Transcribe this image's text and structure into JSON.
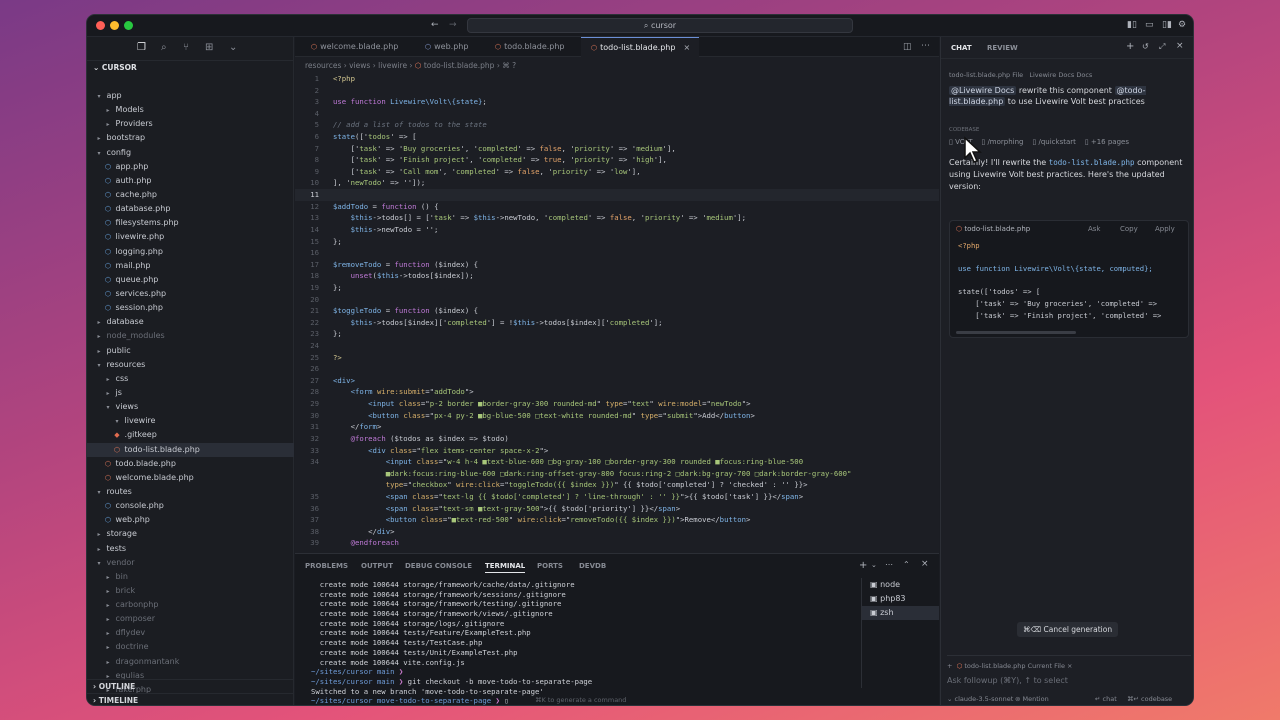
{
  "colors": {
    "kw": "#c07ad8",
    "str": "#a8c77a",
    "var": "#7fb5e8",
    "num": "#e5a46a",
    "cmt": "#6c7480",
    "fn": "#7fb5e8",
    "tag": "#7fb5e8",
    "attr": "#d7b06a",
    "plain": "#c9ccd3"
  },
  "titlebar": {
    "search": "cursor"
  },
  "sidebar": {
    "root": "CURSOR",
    "items": [
      {
        "label": "app",
        "d": 1,
        "k": "open"
      },
      {
        "label": "Models",
        "d": 2,
        "k": "closed",
        "dim": false
      },
      {
        "label": "Providers",
        "d": 2,
        "k": "closed"
      },
      {
        "label": "bootstrap",
        "d": 1,
        "k": "closed"
      },
      {
        "label": "config",
        "d": 1,
        "k": "open"
      },
      {
        "label": "app.php",
        "d": 2,
        "k": "php"
      },
      {
        "label": "auth.php",
        "d": 2,
        "k": "php"
      },
      {
        "label": "cache.php",
        "d": 2,
        "k": "php"
      },
      {
        "label": "database.php",
        "d": 2,
        "k": "php"
      },
      {
        "label": "filesystems.php",
        "d": 2,
        "k": "php"
      },
      {
        "label": "livewire.php",
        "d": 2,
        "k": "php"
      },
      {
        "label": "logging.php",
        "d": 2,
        "k": "php"
      },
      {
        "label": "mail.php",
        "d": 2,
        "k": "php"
      },
      {
        "label": "queue.php",
        "d": 2,
        "k": "php"
      },
      {
        "label": "services.php",
        "d": 2,
        "k": "php"
      },
      {
        "label": "session.php",
        "d": 2,
        "k": "php"
      },
      {
        "label": "database",
        "d": 1,
        "k": "closed"
      },
      {
        "label": "node_modules",
        "d": 1,
        "k": "closed",
        "dim": true
      },
      {
        "label": "public",
        "d": 1,
        "k": "closed"
      },
      {
        "label": "resources",
        "d": 1,
        "k": "open"
      },
      {
        "label": "css",
        "d": 2,
        "k": "closed"
      },
      {
        "label": "js",
        "d": 2,
        "k": "closed"
      },
      {
        "label": "views",
        "d": 2,
        "k": "open"
      },
      {
        "label": "livewire",
        "d": 3,
        "k": "open"
      },
      {
        "label": ".gitkeep",
        "d": 3,
        "k": "git"
      },
      {
        "label": "todo-list.blade.php",
        "d": 3,
        "k": "blade",
        "sel": true
      },
      {
        "label": "todo.blade.php",
        "d": 2,
        "k": "blade"
      },
      {
        "label": "welcome.blade.php",
        "d": 2,
        "k": "blade"
      },
      {
        "label": "routes",
        "d": 1,
        "k": "open"
      },
      {
        "label": "console.php",
        "d": 2,
        "k": "php"
      },
      {
        "label": "web.php",
        "d": 2,
        "k": "php"
      },
      {
        "label": "storage",
        "d": 1,
        "k": "closed"
      },
      {
        "label": "tests",
        "d": 1,
        "k": "closed"
      },
      {
        "label": "vendor",
        "d": 1,
        "k": "open",
        "dim": true
      },
      {
        "label": "bin",
        "d": 2,
        "k": "closed",
        "dim": true
      },
      {
        "label": "brick",
        "d": 2,
        "k": "closed",
        "dim": true
      },
      {
        "label": "carbonphp",
        "d": 2,
        "k": "closed",
        "dim": true
      },
      {
        "label": "composer",
        "d": 2,
        "k": "closed",
        "dim": true
      },
      {
        "label": "dflydev",
        "d": 2,
        "k": "closed",
        "dim": true
      },
      {
        "label": "doctrine",
        "d": 2,
        "k": "closed",
        "dim": true
      },
      {
        "label": "dragonmantank",
        "d": 2,
        "k": "closed",
        "dim": true
      },
      {
        "label": "egulias",
        "d": 2,
        "k": "closed",
        "dim": true
      },
      {
        "label": "fakerphp",
        "d": 2,
        "k": "closed",
        "dim": true
      }
    ],
    "outline": "OUTLINE",
    "timeline": "TIMELINE"
  },
  "tabs": [
    "welcome.blade.php",
    "web.php",
    "todo.blade.php",
    "todo-list.blade.php"
  ],
  "breadcrumb": {
    "a": "resources",
    "b": "views",
    "c": "livewire",
    "d": "todo-list.blade.php"
  },
  "code": [
    [
      [
        "t",
        "<?php"
      ]
    ],
    [],
    [
      [
        "kw",
        "use function "
      ],
      [
        "fn",
        "Livewire\\Volt\\{state}"
      ],
      [
        "plain",
        ";"
      ]
    ],
    [],
    [
      [
        "cmt",
        "// add a list of todos to the state"
      ]
    ],
    [
      [
        "fn",
        "state"
      ],
      [
        "plain",
        "(['"
      ],
      [
        "str",
        "todos"
      ],
      [
        "plain",
        "' => ["
      ]
    ],
    [
      [
        "plain",
        "    ['"
      ],
      [
        "str",
        "task"
      ],
      [
        "plain",
        "' => '"
      ],
      [
        "str",
        "Buy groceries"
      ],
      [
        "plain",
        "', '"
      ],
      [
        "str",
        "completed"
      ],
      [
        "plain",
        "' => "
      ],
      [
        "num",
        "false"
      ],
      [
        "plain",
        ", '"
      ],
      [
        "str",
        "priority"
      ],
      [
        "plain",
        "' => '"
      ],
      [
        "str",
        "medium"
      ],
      [
        "plain",
        "'],"
      ]
    ],
    [
      [
        "plain",
        "    ['"
      ],
      [
        "str",
        "task"
      ],
      [
        "plain",
        "' => '"
      ],
      [
        "str",
        "Finish project"
      ],
      [
        "plain",
        "', '"
      ],
      [
        "str",
        "completed"
      ],
      [
        "plain",
        "' => "
      ],
      [
        "num",
        "true"
      ],
      [
        "plain",
        ", '"
      ],
      [
        "str",
        "priority"
      ],
      [
        "plain",
        "' => '"
      ],
      [
        "str",
        "high"
      ],
      [
        "plain",
        "'],"
      ]
    ],
    [
      [
        "plain",
        "    ['"
      ],
      [
        "str",
        "task"
      ],
      [
        "plain",
        "' => '"
      ],
      [
        "str",
        "Call mom"
      ],
      [
        "plain",
        "', '"
      ],
      [
        "str",
        "completed"
      ],
      [
        "plain",
        "' => "
      ],
      [
        "num",
        "false"
      ],
      [
        "plain",
        ", '"
      ],
      [
        "str",
        "priority"
      ],
      [
        "plain",
        "' => '"
      ],
      [
        "str",
        "low"
      ],
      [
        "plain",
        "'],"
      ]
    ],
    [
      [
        "plain",
        "], '"
      ],
      [
        "str",
        "newTodo"
      ],
      [
        "plain",
        "' => '']);"
      ]
    ],
    [],
    [
      [
        "var",
        "$addTodo"
      ],
      [
        "plain",
        " = "
      ],
      [
        "kw",
        "function"
      ],
      [
        "plain",
        " () {"
      ]
    ],
    [
      [
        "plain",
        "    "
      ],
      [
        "var",
        "$this"
      ],
      [
        "plain",
        "->todos[] = ['"
      ],
      [
        "str",
        "task"
      ],
      [
        "plain",
        "' => "
      ],
      [
        "var",
        "$this"
      ],
      [
        "plain",
        "->newTodo, '"
      ],
      [
        "str",
        "completed"
      ],
      [
        "plain",
        "' => "
      ],
      [
        "num",
        "false"
      ],
      [
        "plain",
        ", '"
      ],
      [
        "str",
        "priority"
      ],
      [
        "plain",
        "' => '"
      ],
      [
        "str",
        "medium"
      ],
      [
        "plain",
        "'];"
      ]
    ],
    [
      [
        "plain",
        "    "
      ],
      [
        "var",
        "$this"
      ],
      [
        "plain",
        "->newTodo = '';"
      ]
    ],
    [
      [
        "plain",
        "};"
      ]
    ],
    [],
    [
      [
        "var",
        "$removeTodo"
      ],
      [
        "plain",
        " = "
      ],
      [
        "kw",
        "function"
      ],
      [
        "plain",
        " ($index) {"
      ]
    ],
    [
      [
        "plain",
        "    "
      ],
      [
        "kw",
        "unset"
      ],
      [
        "plain",
        "("
      ],
      [
        "var",
        "$this"
      ],
      [
        "plain",
        "->todos[$index]);"
      ]
    ],
    [
      [
        "plain",
        "};"
      ]
    ],
    [],
    [
      [
        "var",
        "$toggleTodo"
      ],
      [
        "plain",
        " = "
      ],
      [
        "kw",
        "function"
      ],
      [
        "plain",
        " ($index) {"
      ]
    ],
    [
      [
        "plain",
        "    "
      ],
      [
        "var",
        "$this"
      ],
      [
        "plain",
        "->todos[$index]['"
      ],
      [
        "str",
        "completed"
      ],
      [
        "plain",
        "'] = !"
      ],
      [
        "var",
        "$this"
      ],
      [
        "plain",
        "->todos[$index]['"
      ],
      [
        "str",
        "completed"
      ],
      [
        "plain",
        "'];"
      ]
    ],
    [
      [
        "plain",
        "};"
      ]
    ],
    [],
    [
      [
        "t",
        "?>"
      ]
    ],
    [],
    [
      [
        "tag",
        "<div>"
      ]
    ],
    [
      [
        "plain",
        "    "
      ],
      [
        "tag",
        "<form "
      ],
      [
        "attr",
        "wire:submit"
      ],
      [
        "plain",
        "=\""
      ],
      [
        "str",
        "addTodo"
      ],
      [
        "plain",
        "\">"
      ]
    ],
    [
      [
        "plain",
        "        "
      ],
      [
        "tag",
        "<input "
      ],
      [
        "attr",
        "class"
      ],
      [
        "plain",
        "=\""
      ],
      [
        "str",
        "p-2 border ■border-gray-300 rounded-md"
      ],
      [
        "plain",
        "\" "
      ],
      [
        "attr",
        "type"
      ],
      [
        "plain",
        "=\""
      ],
      [
        "str",
        "text"
      ],
      [
        "plain",
        "\" "
      ],
      [
        "attr",
        "wire:model"
      ],
      [
        "plain",
        "=\""
      ],
      [
        "str",
        "newTodo"
      ],
      [
        "plain",
        "\">"
      ]
    ],
    [
      [
        "plain",
        "        "
      ],
      [
        "tag",
        "<button "
      ],
      [
        "attr",
        "class"
      ],
      [
        "plain",
        "=\""
      ],
      [
        "str",
        "px-4 py-2 ■bg-blue-500 □text-white rounded-md"
      ],
      [
        "plain",
        "\" "
      ],
      [
        "attr",
        "type"
      ],
      [
        "plain",
        "=\""
      ],
      [
        "str",
        "submit"
      ],
      [
        "plain",
        "\">Add</"
      ],
      [
        "tag",
        "button"
      ],
      [
        "plain",
        ">"
      ]
    ],
    [
      [
        "plain",
        "    </"
      ],
      [
        "tag",
        "form"
      ],
      [
        "plain",
        ">"
      ]
    ],
    [
      [
        "plain",
        "    "
      ],
      [
        "kw",
        "@foreach"
      ],
      [
        "plain",
        " ($todos as $index => $todo)"
      ]
    ],
    [
      [
        "plain",
        "        "
      ],
      [
        "tag",
        "<div "
      ],
      [
        "attr",
        "class"
      ],
      [
        "plain",
        "=\""
      ],
      [
        "str",
        "flex items-center space-x-2"
      ],
      [
        "plain",
        "\">"
      ]
    ],
    [
      [
        "plain",
        "            "
      ],
      [
        "tag",
        "<input "
      ],
      [
        "attr",
        "class"
      ],
      [
        "plain",
        "=\""
      ],
      [
        "str",
        "w-4 h-4 ■text-blue-600 □bg-gray-100 □border-gray-300 rounded ■focus:ring-blue-500"
      ]
    ],
    [
      [
        "plain",
        "            "
      ],
      [
        "str",
        "■dark:focus:ring-blue-600 □dark:ring-offset-gray-800 focus:ring-2 □dark:bg-gray-700 □dark:border-gray-600\""
      ]
    ],
    [
      [
        "plain",
        "            "
      ],
      [
        "attr",
        "type"
      ],
      [
        "plain",
        "=\""
      ],
      [
        "str",
        "checkbox"
      ],
      [
        "plain",
        "\" "
      ],
      [
        "attr",
        "wire:click"
      ],
      [
        "plain",
        "=\""
      ],
      [
        "str",
        "toggleTodo({{ $index }})"
      ],
      [
        "plain",
        "\" {{ $todo['completed'] ? 'checked' : '' }}>"
      ]
    ],
    [
      [
        "plain",
        "            "
      ],
      [
        "tag",
        "<span "
      ],
      [
        "attr",
        "class"
      ],
      [
        "plain",
        "=\""
      ],
      [
        "str",
        "text-lg {{ $todo['completed'] ? 'line-through' : '' }}"
      ],
      [
        "plain",
        "\">{{ $todo['task'] }}</"
      ],
      [
        "tag",
        "span"
      ],
      [
        "plain",
        ">"
      ]
    ],
    [
      [
        "plain",
        "            "
      ],
      [
        "tag",
        "<span "
      ],
      [
        "attr",
        "class"
      ],
      [
        "plain",
        "=\""
      ],
      [
        "str",
        "text-sm ■text-gray-500"
      ],
      [
        "plain",
        "\">{{ $todo['priority'] }}</"
      ],
      [
        "tag",
        "span"
      ],
      [
        "plain",
        ">"
      ]
    ],
    [
      [
        "plain",
        "            "
      ],
      [
        "tag",
        "<button "
      ],
      [
        "attr",
        "class"
      ],
      [
        "plain",
        "=\""
      ],
      [
        "str",
        "■text-red-500"
      ],
      [
        "plain",
        "\" "
      ],
      [
        "attr",
        "wire:click"
      ],
      [
        "plain",
        "=\""
      ],
      [
        "str",
        "removeTodo({{ $index }})"
      ],
      [
        "plain",
        "\">Remove</"
      ],
      [
        "tag",
        "button"
      ],
      [
        "plain",
        ">"
      ]
    ],
    [
      [
        "plain",
        "        </"
      ],
      [
        "tag",
        "div"
      ],
      [
        "plain",
        ">"
      ]
    ],
    [
      [
        "plain",
        "    "
      ],
      [
        "kw",
        "@endforeach"
      ]
    ]
  ],
  "code_numbers": [
    "1",
    "2",
    "3",
    "4",
    "5",
    "6",
    "7",
    "8",
    "9",
    "10",
    "11",
    "12",
    "13",
    "14",
    "15",
    "16",
    "17",
    "18",
    "19",
    "20",
    "21",
    "22",
    "23",
    "24",
    "25",
    "26",
    "27",
    "28",
    "29",
    "30",
    "31",
    "32",
    "33",
    "34",
    "",
    "",
    "35",
    "36",
    "37",
    "38",
    "39"
  ],
  "panel": {
    "tabs": [
      "PROBLEMS",
      "OUTPUT",
      "DEBUG CONSOLE",
      "TERMINAL",
      "PORTS",
      "DEVDB"
    ],
    "terminal": [
      "  create mode 100644 storage/framework/cache/data/.gitignore",
      "  create mode 100644 storage/framework/sessions/.gitignore",
      "  create mode 100644 storage/framework/testing/.gitignore",
      "  create mode 100644 storage/framework/views/.gitignore",
      "  create mode 100644 storage/logs/.gitignore",
      "  create mode 100644 tests/Feature/ExampleTest.php",
      "  create mode 100644 tests/TestCase.php",
      "  create mode 100644 tests/Unit/ExampleTest.php",
      "  create mode 100644 vite.config.js"
    ],
    "prompt1": "~/sites/cursor main ",
    "prompt2": "~/sites/cursor main ",
    "cmd": "git checkout -b move-todo-to-separate-page",
    "switched": "Switched to a new branch 'move-todo-to-separate-page'",
    "prompt3": "~/sites/cursor move-todo-to-separate-page ",
    "shells": [
      "node",
      "php83",
      "zsh"
    ],
    "hint": "⌘K to generate a command"
  },
  "chat": {
    "tabs": [
      "CHAT",
      "REVIEW"
    ],
    "file_chip": "todo-list.blade.php File",
    "docs_chip": "Livewire Docs Docs",
    "mention_docs": "@Livewire Docs",
    "msg_a": " rewrite this component ",
    "mention_file": "@todo-list.blade.php",
    "msg_b": " to use Livewire Volt best practices",
    "context_label": "CODEBASE",
    "refs": [
      "VOLT",
      "/morphing",
      "/quickstart",
      "+16 pages"
    ],
    "reply_a": "Certainly! I'll rewrite the ",
    "reply_file": "todo-list.blade.php",
    "reply_b": " component using Livewire Volt best practices. Here's the updated version:",
    "codefile": "todo-list.blade.php",
    "code_actions": [
      "Ask",
      "Copy",
      "Apply"
    ],
    "code": [
      "<?php",
      "",
      "use function Livewire\\Volt\\{state, computed};",
      "",
      "state(['todos' => [",
      "    ['task' => 'Buy groceries', 'completed' =>",
      "    ['task' => 'Finish project', 'completed' =>"
    ],
    "cancel": "⌘⌫ Cancel generation",
    "current_file": "todo-list.blade.php Current File",
    "placeholder": "Ask followup (⌘Y), ↑ to select",
    "model": "claude-3.5-sonnet",
    "mention": "Mention",
    "chat_btn": "chat",
    "codebase_btn": "codebase"
  }
}
